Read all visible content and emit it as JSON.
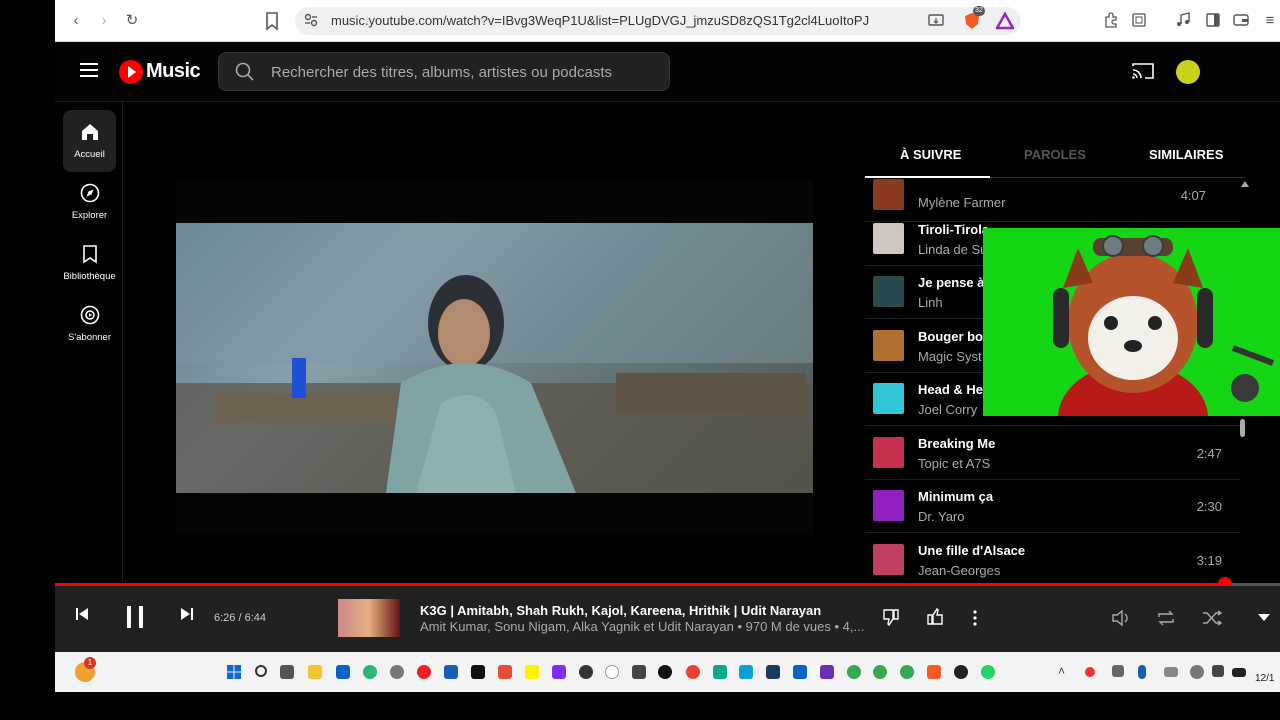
{
  "browser": {
    "url": "music.youtube.com/watch?v=IBvg3WeqP1U&list=PLUgDVGJ_jmzuSD8zQS1Tg2cl4LuoItoPJ",
    "extension_badge": "32"
  },
  "header": {
    "logo_text": "Music",
    "search_placeholder": "Rechercher des titres, albums, artistes ou podcasts"
  },
  "sidebar": {
    "items": [
      {
        "label": "Accueil",
        "icon": "home-icon"
      },
      {
        "label": "Explorer",
        "icon": "compass-icon"
      },
      {
        "label": "Bibliothèque",
        "icon": "bookmark-icon"
      },
      {
        "label": "S'abonner",
        "icon": "subscribe-icon"
      }
    ]
  },
  "tabs": [
    {
      "label": "À SUIVRE",
      "active": true
    },
    {
      "label": "PAROLES",
      "active": false
    },
    {
      "label": "SIMILAIRES",
      "active": false
    }
  ],
  "queue": [
    {
      "title": "",
      "artist": "Mylène Farmer",
      "duration": "4:07",
      "color": "#8a3a20"
    },
    {
      "title": "Tiroli-Tirola",
      "artist": "Linda de Su",
      "duration": "",
      "color": "#d0c8c0"
    },
    {
      "title": "Je pense à",
      "artist": "Linh",
      "duration": "",
      "color": "#2a4a50"
    },
    {
      "title": "Bouger bou",
      "artist": "Magic Syst",
      "duration": "",
      "color": "#b07030"
    },
    {
      "title": "Head & Hea",
      "artist": "Joel Corry",
      "duration": "",
      "color": "#30c8d8"
    },
    {
      "title": "Breaking Me",
      "artist": "Topic et A7S",
      "duration": "2:47",
      "color": "#c83050"
    },
    {
      "title": "Minimum ça",
      "artist": "Dr. Yaro",
      "duration": "2:30",
      "color": "#9020c0"
    },
    {
      "title": "Une fille d'Alsace",
      "artist": "Jean-Georges",
      "duration": "3:19",
      "color": "#c04060"
    }
  ],
  "player": {
    "time": "6:26 / 6:44",
    "progress": 0.955,
    "track_title": "K3G | Amitabh, Shah Rukh, Kajol, Kareena, Hrithik | Udit Narayan",
    "track_subtitle": "Amit Kumar, Sonu Nigam, Alka Yagnik et Udit Narayan • 970 M de vues • 4,...",
    "accent": "#ff0000"
  },
  "taskbar": {
    "notification_count": "1",
    "date": "12/1"
  }
}
